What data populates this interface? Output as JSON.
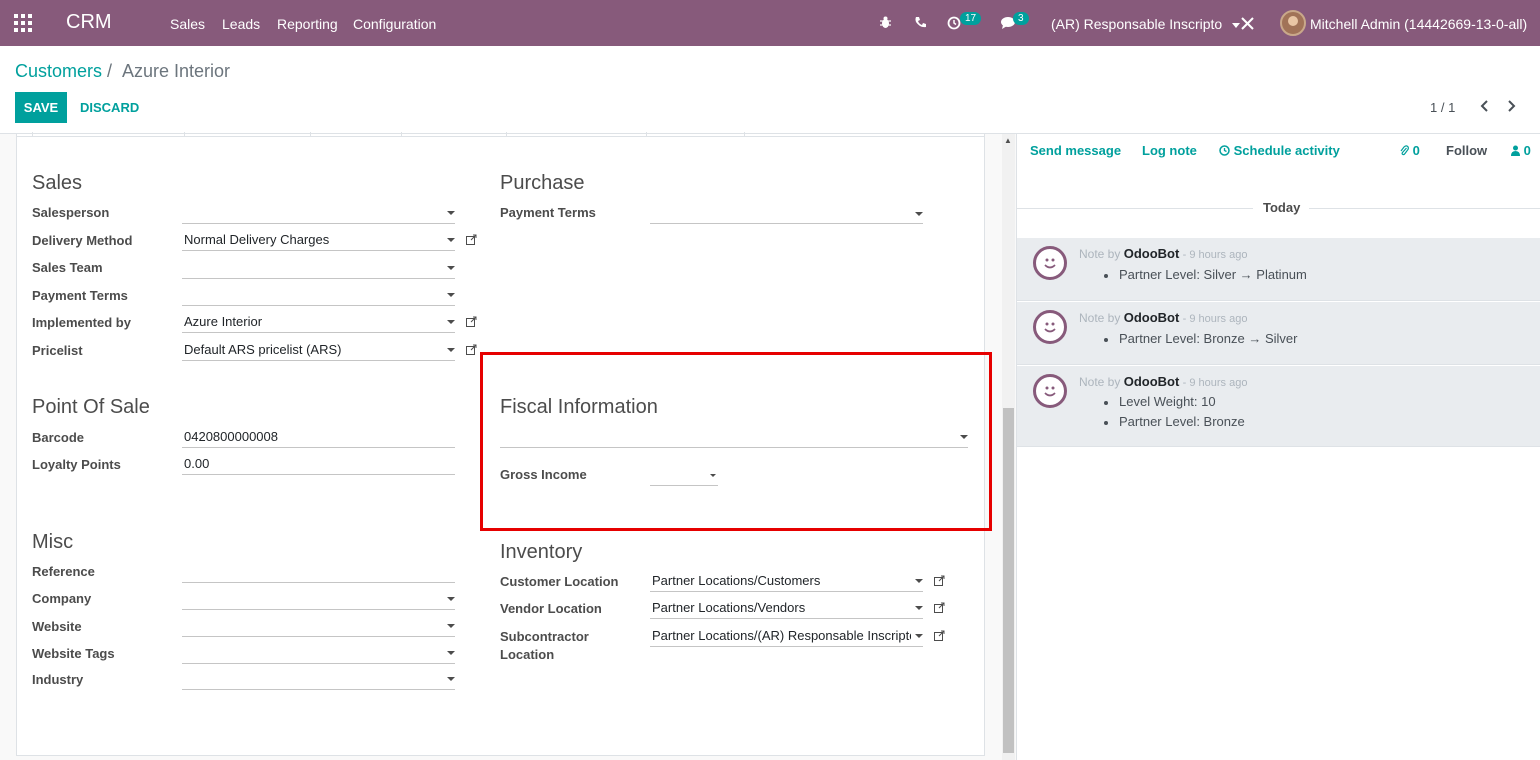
{
  "navbar": {
    "brand": "CRM",
    "menu": [
      "Sales",
      "Leads",
      "Reporting",
      "Configuration"
    ],
    "activity_count": "17",
    "message_count": "3",
    "company": "(AR) Responsable Inscripto",
    "user": "Mitchell Admin (14442669-13-0-all)"
  },
  "breadcrumb": {
    "parent": "Customers",
    "sep": "/",
    "current": "Azure Interior"
  },
  "buttons": {
    "save": "SAVE",
    "discard": "DISCARD"
  },
  "pager": {
    "value": "1 / 1"
  },
  "sales": {
    "title": "Sales",
    "salesperson_label": "Salesperson",
    "salesperson_value": "",
    "delivery_label": "Delivery Method",
    "delivery_value": "Normal Delivery Charges",
    "team_label": "Sales Team",
    "team_value": "",
    "payterms_label": "Payment Terms",
    "payterms_value": "",
    "implemented_label": "Implemented by",
    "implemented_value": "Azure Interior",
    "pricelist_label": "Pricelist",
    "pricelist_value": "Default ARS pricelist (ARS)"
  },
  "purchase": {
    "title": "Purchase",
    "payterms_label": "Payment Terms",
    "payterms_value": ""
  },
  "pos": {
    "title": "Point Of Sale",
    "barcode_label": "Barcode",
    "barcode_value": "0420800000008",
    "loyalty_label": "Loyalty Points",
    "loyalty_value": "0.00"
  },
  "fiscal": {
    "title": "Fiscal Information",
    "position_value": "",
    "gross_label": "Gross Income",
    "gross_value": ""
  },
  "misc": {
    "title": "Misc",
    "reference_label": "Reference",
    "company_label": "Company",
    "website_label": "Website",
    "tags_label": "Website Tags",
    "industry_label": "Industry"
  },
  "inventory": {
    "title": "Inventory",
    "customer_label": "Customer Location",
    "customer_value": "Partner Locations/Customers",
    "vendor_label": "Vendor Location",
    "vendor_value": "Partner Locations/Vendors",
    "sub_label_1": "Subcontractor",
    "sub_label_2": "Location",
    "sub_value": "Partner Locations/(AR) Responsable Inscripto"
  },
  "chatter": {
    "send_message": "Send message",
    "log_note": "Log note",
    "schedule": "Schedule activity",
    "attachments": "0",
    "follow": "Follow",
    "followers": "0",
    "today": "Today",
    "messages": [
      {
        "prefix": "Note by",
        "author": "OdooBot",
        "time": "- 9 hours ago",
        "lines": [
          "Partner Level: Silver → Platinum"
        ]
      },
      {
        "prefix": "Note by",
        "author": "OdooBot",
        "time": "- 9 hours ago",
        "lines": [
          "Partner Level: Bronze → Silver"
        ]
      },
      {
        "prefix": "Note by",
        "author": "OdooBot",
        "time": "- 9 hours ago",
        "lines": [
          "Level Weight: 10",
          "Partner Level: Bronze"
        ]
      }
    ]
  }
}
